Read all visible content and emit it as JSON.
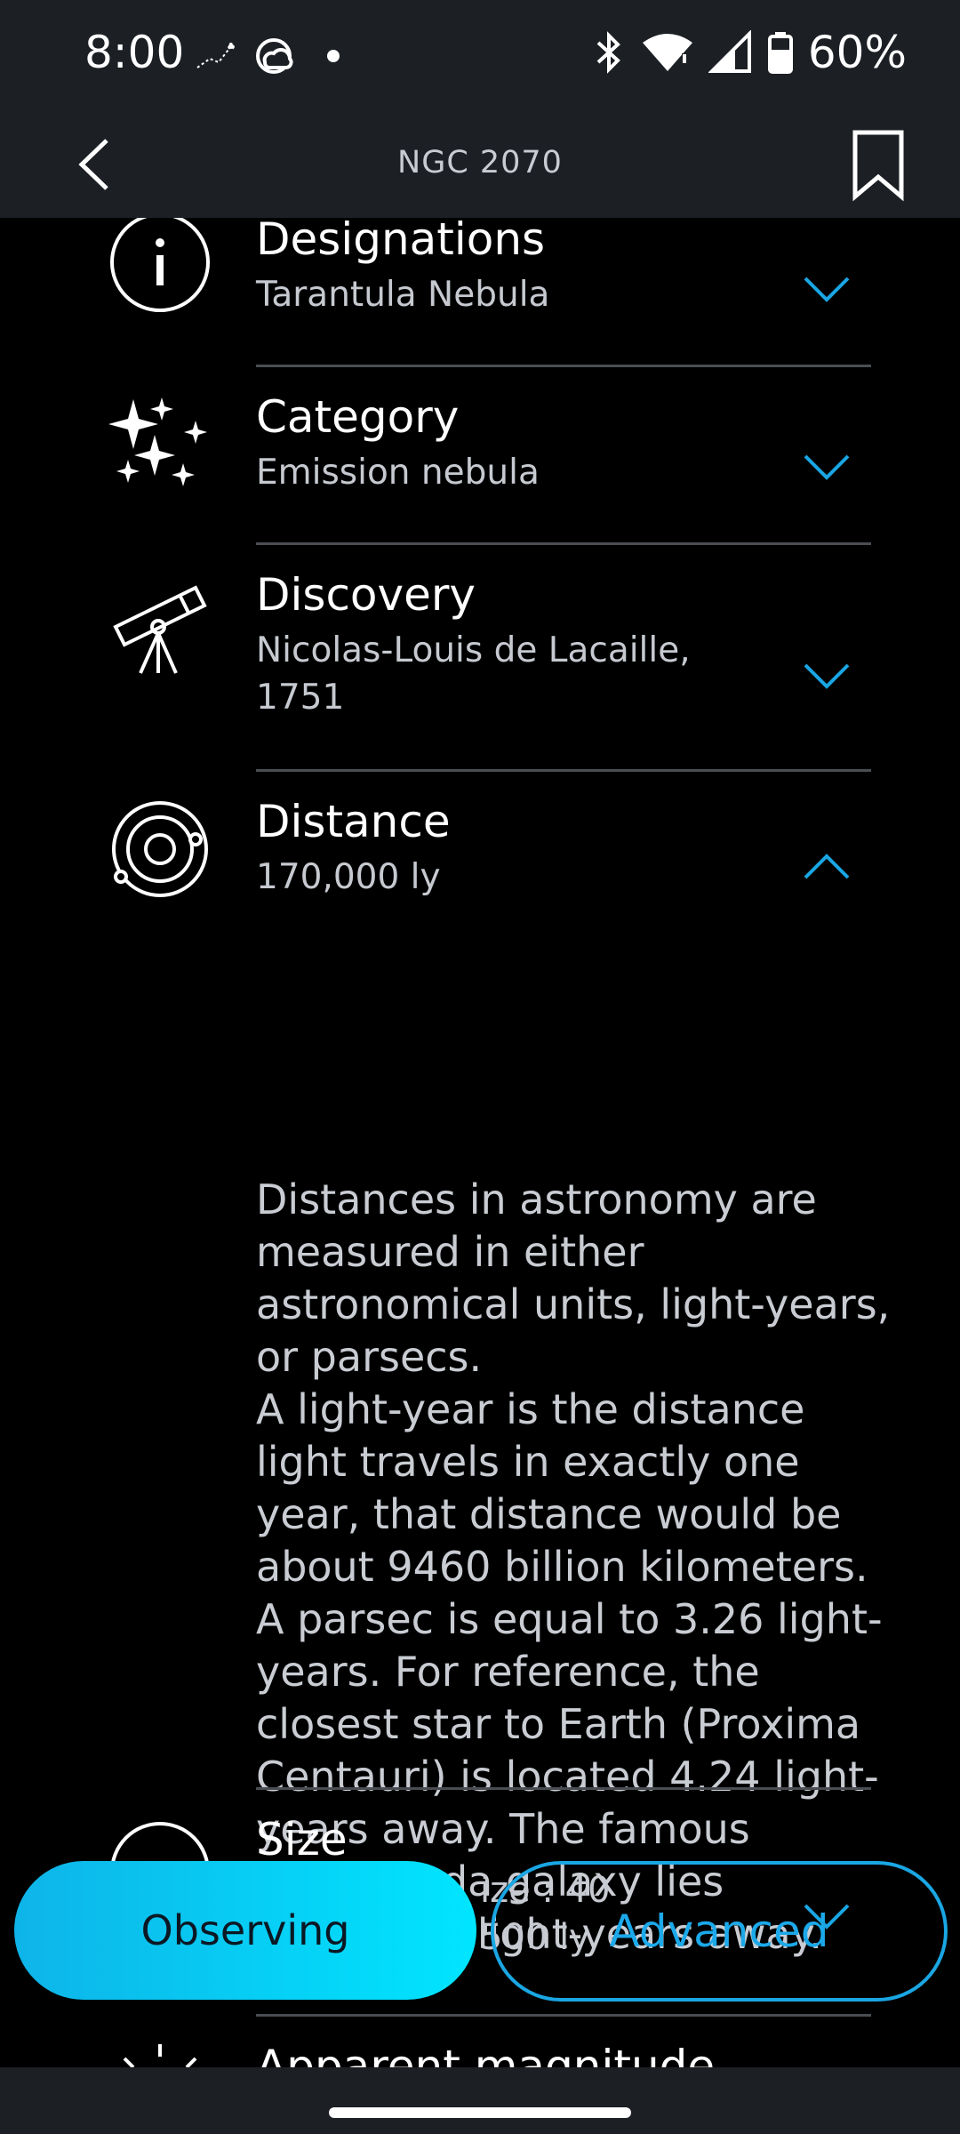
{
  "status": {
    "time": "8:00",
    "battery": "60%",
    "icons": [
      "constellation-icon",
      "weather-icon",
      "dot-icon",
      "bluetooth-icon",
      "wifi-icon",
      "signal-icon",
      "battery-icon"
    ]
  },
  "header": {
    "title": "NGC 2070",
    "back_icon": "chevron-left-icon",
    "bookmark_icon": "bookmark-icon"
  },
  "sections": [
    {
      "title": "Designations",
      "value": "Tarantula Nebula",
      "icon": "info-icon",
      "expanded": false
    },
    {
      "title": "Category",
      "value": "Emission nebula",
      "icon": "sparkles-icon",
      "expanded": false
    },
    {
      "title": "Discovery",
      "value": "Nicolas-Louis de Lacaille, 1751",
      "icon": "telescope-icon",
      "expanded": false
    },
    {
      "title": "Distance",
      "value": "170,000 ly",
      "icon": "orbit-icon",
      "expanded": true,
      "description": "Distances in astronomy are measured in either astronomical units, light-years, or parsecs.\nA light-year is the distance light travels in exactly one year, that distance would be about 9460 billion kilometers. A parsec is equal to 3.26 light-years. For reference, the closest star to Earth (Proxima Centauri) is located 4.24 light-years away. The famous Andromeda galaxy lies 2,500,000 light-years away."
    },
    {
      "title": "Size",
      "value_line1": "ize : 40",
      "value_line2": "500 ly",
      "icon": "size-icon",
      "expanded": false
    },
    {
      "title": "Apparent magnitude",
      "icon": "sun-icon"
    }
  ],
  "buttons": {
    "observing": "Observing",
    "advanced": "Advanced"
  },
  "colors": {
    "accent": "#1aa6e3",
    "background": "#000000",
    "bar": "#1c1f24"
  }
}
